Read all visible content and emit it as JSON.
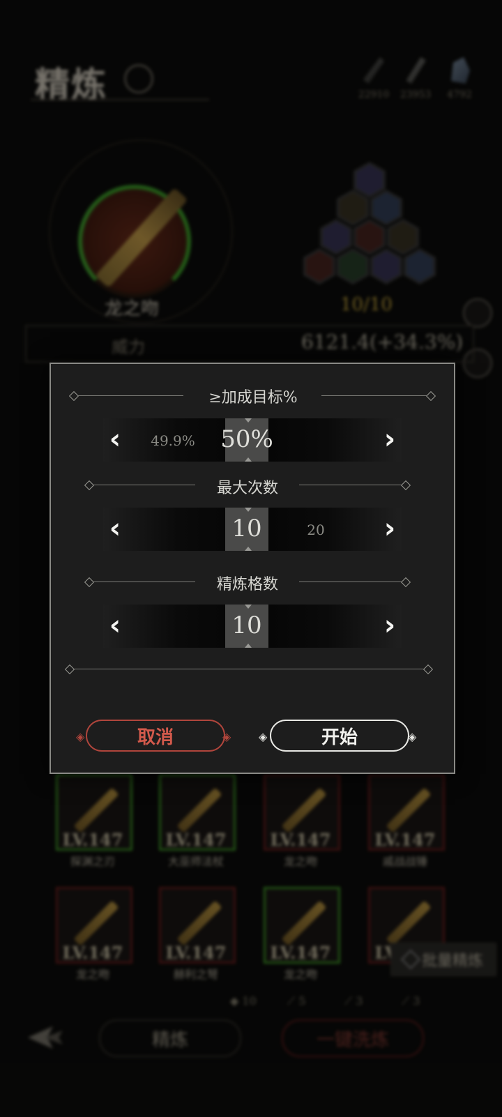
{
  "header": {
    "title": "精炼"
  },
  "currencies": [
    {
      "icon": "feather-icon",
      "value": "22910"
    },
    {
      "icon": "quill-icon",
      "value": "23953"
    },
    {
      "icon": "ore-icon",
      "value": "4792"
    }
  ],
  "equipment": {
    "name": "龙之吻",
    "progress": "10/10"
  },
  "stat": {
    "label": "威力",
    "value": "6121.4(+34.3%)"
  },
  "modal": {
    "sections": [
      {
        "title": "≥加成目标%",
        "prev": "49.9%",
        "current": "50%",
        "next": ""
      },
      {
        "title": "最大次数",
        "prev": "",
        "current": "10",
        "next": "20"
      },
      {
        "title": "精炼格数",
        "prev": "",
        "current": "10",
        "next": ""
      }
    ],
    "cancel_label": "取消",
    "start_label": "开始"
  },
  "items": [
    {
      "level": "LV.147",
      "name": "探渊之刃",
      "border": "green"
    },
    {
      "level": "LV.147",
      "name": "大巫师法杖",
      "border": "green"
    },
    {
      "level": "LV.147",
      "name": "龙之吻",
      "border": "red"
    },
    {
      "level": "LV.147",
      "name": "戚战战锤",
      "border": "red"
    },
    {
      "level": "LV.147",
      "name": "龙之吻",
      "border": "red"
    },
    {
      "level": "LV.147",
      "name": "赫利之弩",
      "border": "red"
    },
    {
      "level": "LV.147",
      "name": "龙之吻",
      "border": "green"
    },
    {
      "level": "LV.147",
      "name": "",
      "border": "red"
    }
  ],
  "batch_label": "批量精炼",
  "materials": [
    {
      "icon": "ore-icon",
      "value": "10"
    },
    {
      "icon": "feather-icon",
      "value": "5"
    },
    {
      "icon": "quill-icon",
      "value": "3"
    },
    {
      "icon": "brush-icon",
      "value": "3"
    }
  ],
  "bottom_tabs": {
    "refine": "精炼",
    "quick": "一键洗炼"
  }
}
